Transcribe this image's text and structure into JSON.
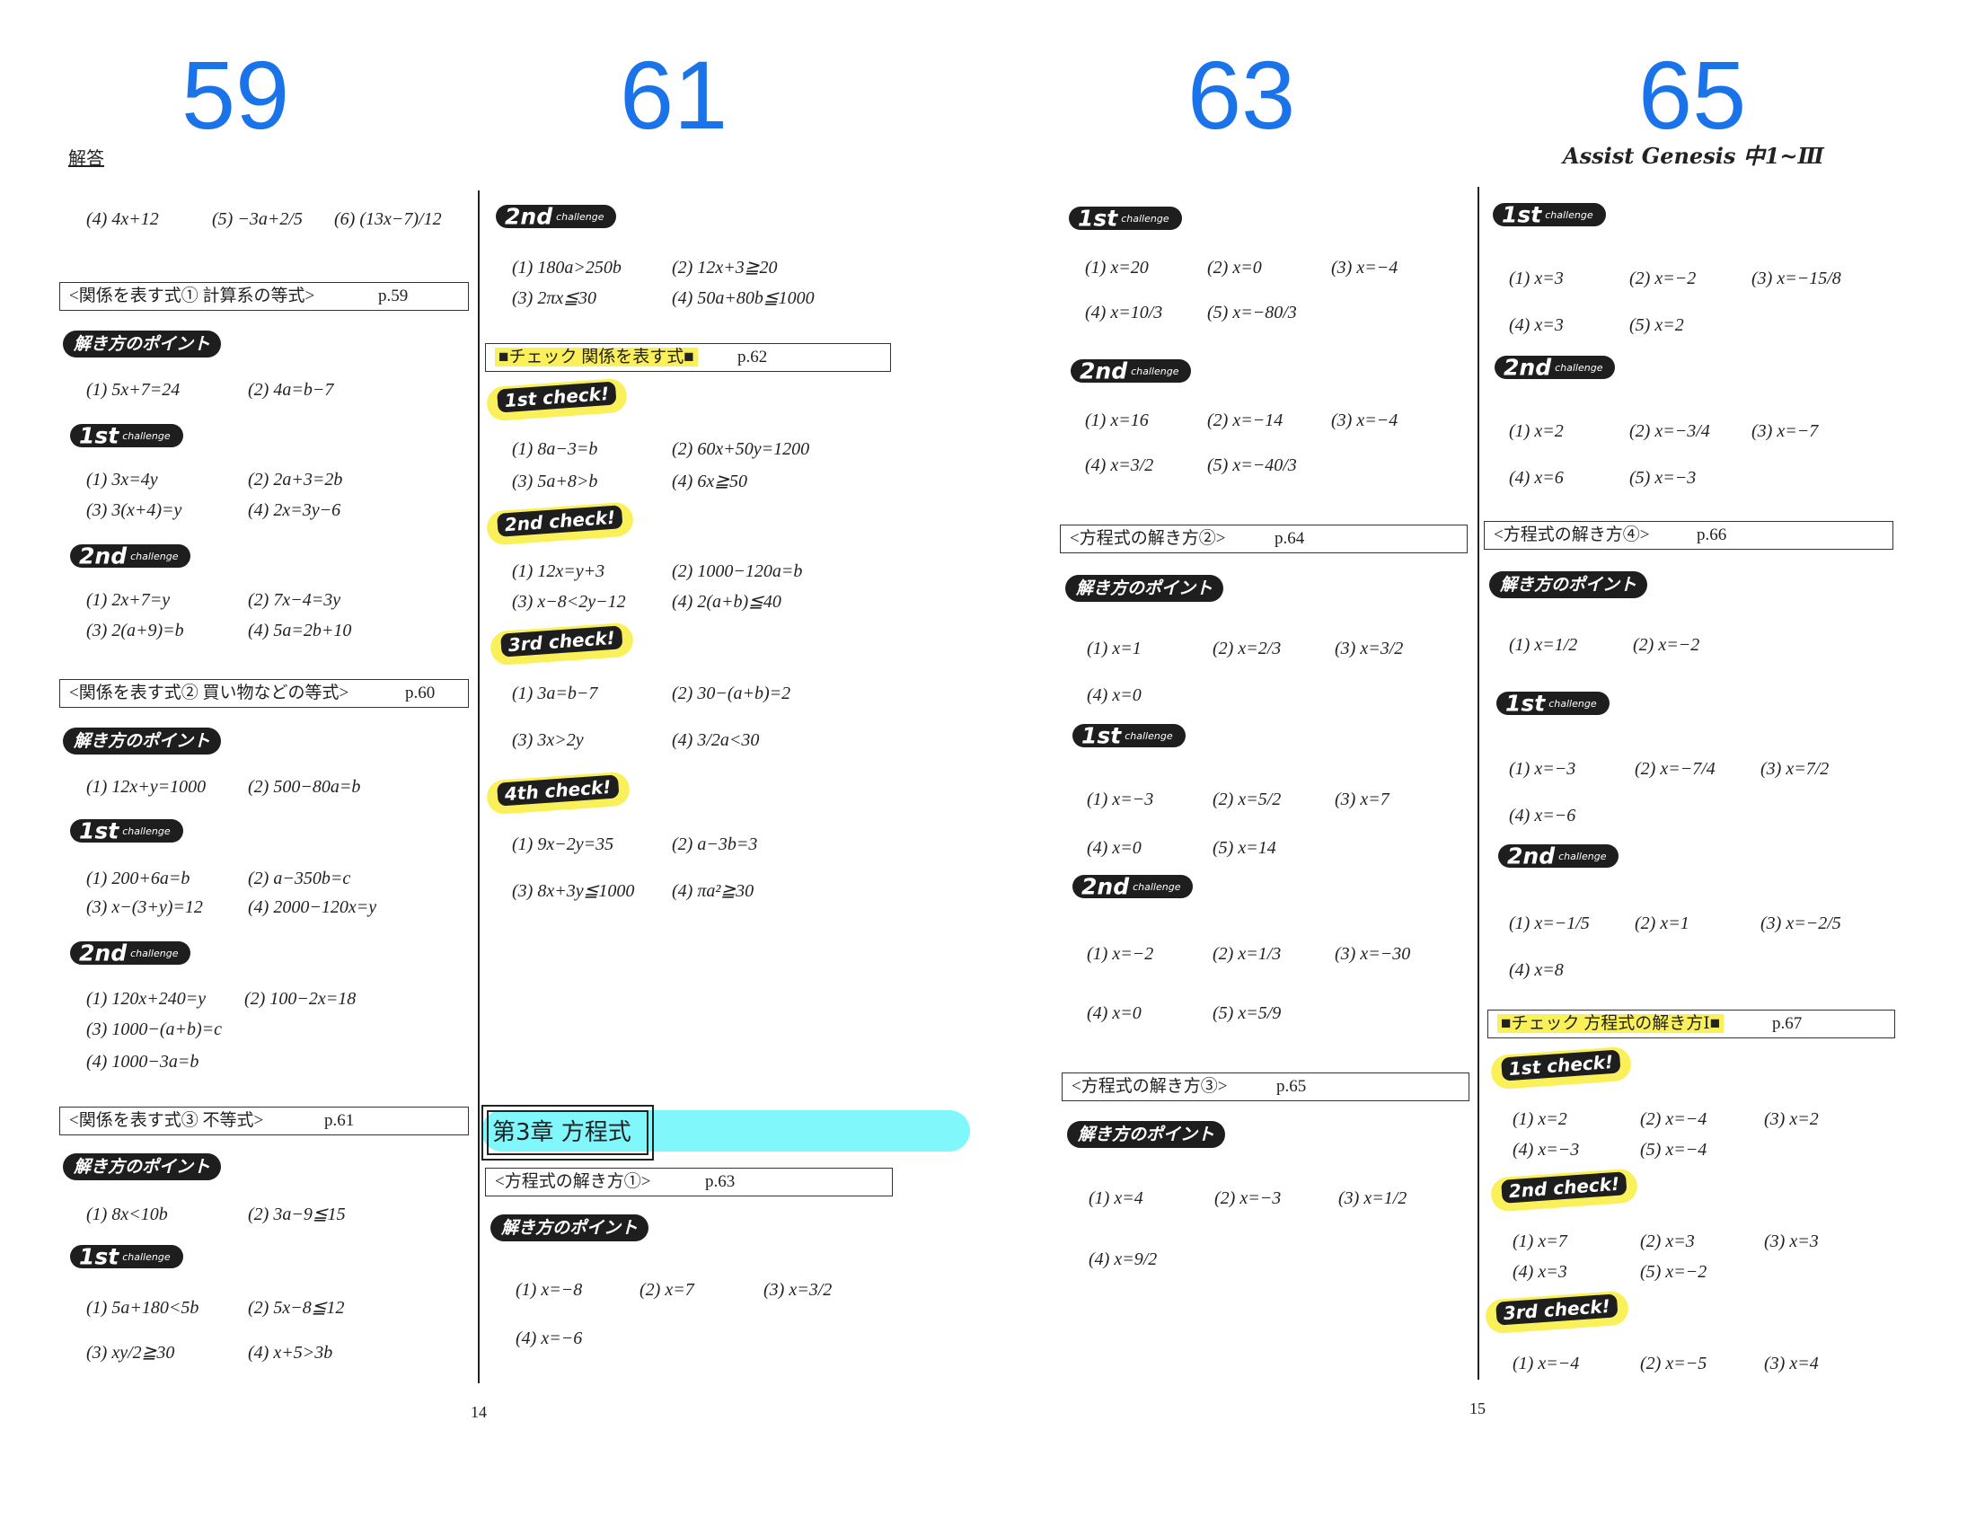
{
  "big_numbers": [
    "59",
    "61",
    "63",
    "65"
  ],
  "header": {
    "answers_label": "解答",
    "logo_text": "Assist Genesis 中1~Ⅲ"
  },
  "page_numbers": {
    "left": "14",
    "right": "15"
  },
  "chapter": {
    "title": "第3章 方程式"
  },
  "col1": {
    "top_line": [
      "(4) 4x+12",
      "(5) −3a+2/5",
      "(6) (13x−7)/12"
    ],
    "sec1": {
      "title": "<関係を表す式① 計算系の等式>",
      "page": "p.59"
    },
    "sec1_point": "解き方のポイント",
    "sec1_point_ans": [
      "(1) 5x+7=24",
      "(2) 4a=b−7"
    ],
    "sec1_1st": {
      "n": "1st",
      "c": "challenge"
    },
    "sec1_1st_ans": [
      "(1) 3x=4y",
      "(2) 2a+3=2b",
      "(3) 3(x+4)=y",
      "(4) 2x=3y−6"
    ],
    "sec1_2nd": {
      "n": "2nd",
      "c": "challenge"
    },
    "sec1_2nd_ans": [
      "(1) 2x+7=y",
      "(2) 7x−4=3y",
      "(3) 2(a+9)=b",
      "(4) 5a=2b+10"
    ],
    "sec2": {
      "title": "<関係を表す式② 買い物などの等式>",
      "page": "p.60"
    },
    "sec2_point": "解き方のポイント",
    "sec2_point_ans": [
      "(1) 12x+y=1000",
      "(2) 500−80a=b"
    ],
    "sec2_1st": {
      "n": "1st",
      "c": "challenge"
    },
    "sec2_1st_ans": [
      "(1) 200+6a=b",
      "(2) a−350b=c",
      "(3) x−(3+y)=12",
      "(4) 2000−120x=y"
    ],
    "sec2_2nd": {
      "n": "2nd",
      "c": "challenge"
    },
    "sec2_2nd_ans": [
      "(1) 120x+240=y",
      "(2) 100−2x=18",
      "(3) 1000−(a+b)=c",
      "(4) 1000−3a=b"
    ],
    "sec3": {
      "title": "<関係を表す式③ 不等式>",
      "page": "p.61"
    },
    "sec3_point": "解き方のポイント",
    "sec3_point_ans": [
      "(1) 8x<10b",
      "(2) 3a−9≦15"
    ],
    "sec3_1st": {
      "n": "1st",
      "c": "challenge"
    },
    "sec3_1st_ans": [
      "(1) 5a+180<5b",
      "(2) 5x−8≦12",
      "(3) xy/2≧30",
      "(4) x+5>3b"
    ]
  },
  "col2": {
    "c2nd": {
      "n": "2nd",
      "c": "challenge"
    },
    "c2nd_ans": [
      "(1) 180a>250b",
      "(2) 12x+3≧20",
      "(3) 2πx≦30",
      "(4) 50a+80b≦1000"
    ],
    "check_title": "■チェック 関係を表す式■",
    "check_page": "p.62",
    "chk1": "1st check!",
    "chk1_ans": [
      "(1) 8a−3=b",
      "(2) 60x+50y=1200",
      "(3) 5a+8>b",
      "(4) 6x≧50"
    ],
    "chk2": "2nd check!",
    "chk2_ans": [
      "(1) 12x=y+3",
      "(2) 1000−120a=b",
      "(3) x−8<2y−12",
      "(4) 2(a+b)≦40"
    ],
    "chk3": "3rd check!",
    "chk3_ans": [
      "(1) 3a=b−7",
      "(2) 30−(a+b)=2",
      "(3) 3x>2y",
      "(4) 3/2a<30"
    ],
    "chk4": "4th check!",
    "chk4_ans": [
      "(1) 9x−2y=35",
      "(2) a−3b=3",
      "(3) 8x+3y≦1000",
      "(4) πa²≧30"
    ],
    "sec": {
      "title": "<方程式の解き方①>",
      "page": "p.63"
    },
    "point": "解き方のポイント",
    "point_ans": [
      "(1) x=−8",
      "(2) x=7",
      "(3) x=3/2",
      "(4) x=−6"
    ]
  },
  "col3": {
    "c1st": {
      "n": "1st",
      "c": "challenge"
    },
    "c1st_ans": [
      "(1) x=20",
      "(2) x=0",
      "(3) x=−4",
      "(4) x=10/3",
      "(5) x=−80/3"
    ],
    "c2nd": {
      "n": "2nd",
      "c": "challenge"
    },
    "c2nd_ans": [
      "(1) x=16",
      "(2) x=−14",
      "(3) x=−4",
      "(4) x=3/2",
      "(5) x=−40/3"
    ],
    "sec1": {
      "title": "<方程式の解き方②>",
      "page": "p.64"
    },
    "point1": "解き方のポイント",
    "point1_ans": [
      "(1) x=1",
      "(2) x=2/3",
      "(3) x=3/2",
      "(4) x=0"
    ],
    "s1_1st": {
      "n": "1st",
      "c": "challenge"
    },
    "s1_1st_ans": [
      "(1) x=−3",
      "(2) x=5/2",
      "(3) x=7",
      "(4) x=0",
      "(5) x=14"
    ],
    "s1_2nd": {
      "n": "2nd",
      "c": "challenge"
    },
    "s1_2nd_ans": [
      "(1) x=−2",
      "(2) x=1/3",
      "(3) x=−30",
      "(4) x=0",
      "(5) x=5/9"
    ],
    "sec2": {
      "title": "<方程式の解き方③>",
      "page": "p.65"
    },
    "point2": "解き方のポイント",
    "point2_ans": [
      "(1) x=4",
      "(2) x=−3",
      "(3) x=1/2",
      "(4) x=9/2"
    ]
  },
  "col4": {
    "c1st": {
      "n": "1st",
      "c": "challenge"
    },
    "c1st_ans": [
      "(1) x=3",
      "(2) x=−2",
      "(3) x=−15/8",
      "(4) x=3",
      "(5) x=2"
    ],
    "c2nd": {
      "n": "2nd",
      "c": "challenge"
    },
    "c2nd_ans": [
      "(1) x=2",
      "(2) x=−3/4",
      "(3) x=−7",
      "(4) x=6",
      "(5) x=−3"
    ],
    "sec": {
      "title": "<方程式の解き方④>",
      "page": "p.66"
    },
    "point": "解き方のポイント",
    "point_ans": [
      "(1) x=1/2",
      "(2) x=−2"
    ],
    "s_1st": {
      "n": "1st",
      "c": "challenge"
    },
    "s_1st_ans": [
      "(1) x=−3",
      "(2) x=−7/4",
      "(3) x=7/2",
      "(4) x=−6"
    ],
    "s_2nd": {
      "n": "2nd",
      "c": "challenge"
    },
    "s_2nd_ans": [
      "(1) x=−1/5",
      "(2) x=1",
      "(3) x=−2/5",
      "(4) x=8"
    ],
    "check_title": "■チェック 方程式の解き方Ⅰ■",
    "check_page": "p.67",
    "chk1": "1st check!",
    "chk1_ans": [
      "(1) x=2",
      "(2) x=−4",
      "(3) x=2",
      "(4) x=−3",
      "(5) x=−4"
    ],
    "chk2": "2nd check!",
    "chk2_ans": [
      "(1) x=7",
      "(2) x=3",
      "(3) x=3",
      "(4) x=3",
      "(5) x=−2"
    ],
    "chk3": "3rd check!",
    "chk3_ans": [
      "(1) x=−4",
      "(2) x=−5",
      "(3) x=4"
    ]
  }
}
